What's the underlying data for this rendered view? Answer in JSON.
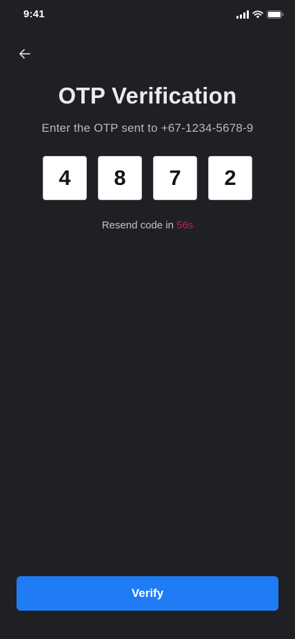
{
  "status_bar": {
    "time": "9:41",
    "icons": [
      "signal-icon",
      "wifi-icon",
      "battery-icon"
    ]
  },
  "header": {
    "back_icon": "arrow-left-icon",
    "title": "OTP Verification",
    "subtitle": "Enter the OTP sent to +67-1234-5678-9"
  },
  "otp": {
    "digits": [
      "4",
      "8",
      "7",
      "2"
    ]
  },
  "resend": {
    "label": "Resend code in ",
    "timer": "56s",
    "timer_color": "#d11d4f"
  },
  "actions": {
    "verify_label": "Verify",
    "accent_color": "#1f7cf5"
  }
}
